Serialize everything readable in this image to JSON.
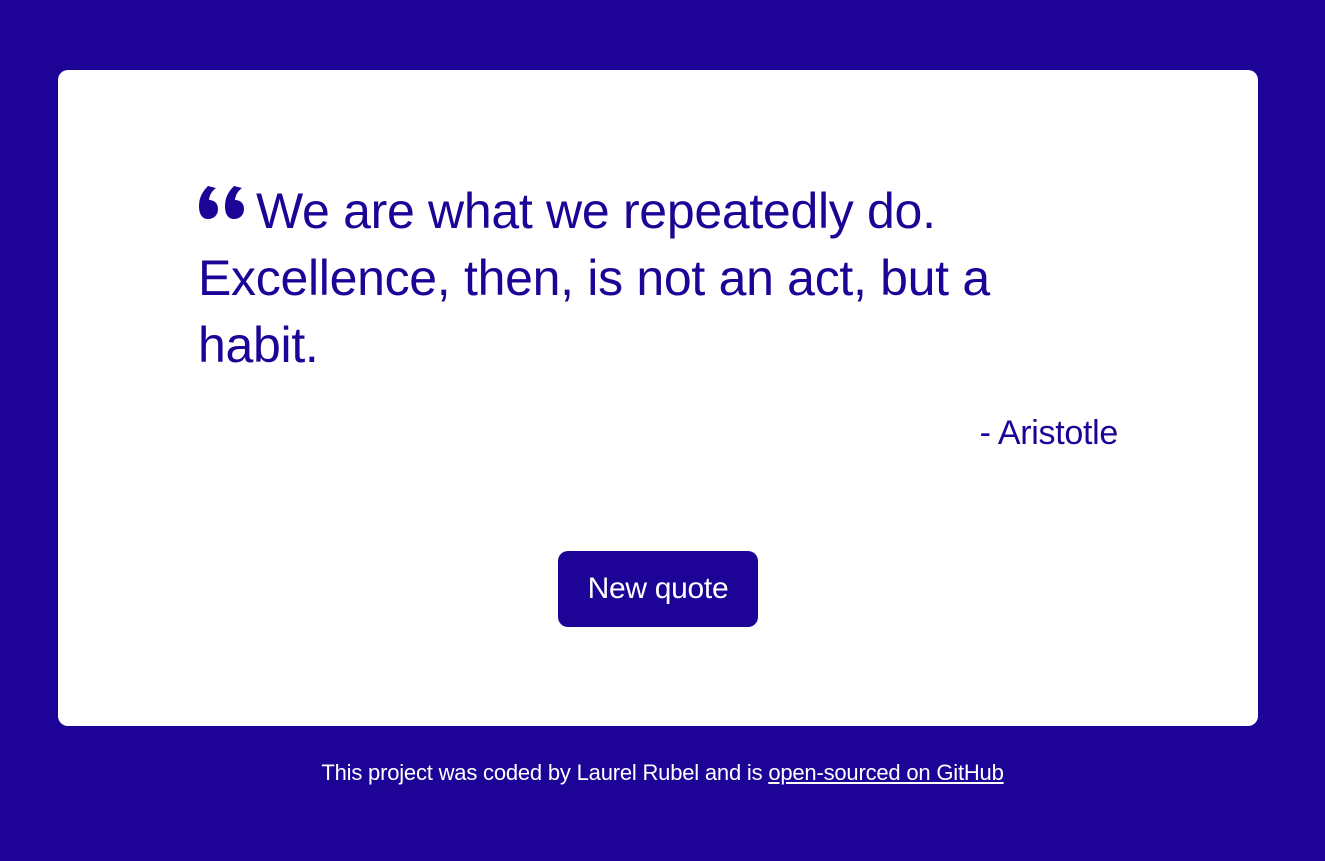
{
  "colors": {
    "background": "#1e0496",
    "card": "#ffffff",
    "accent": "#1e0496",
    "button_text": "#ffffff"
  },
  "quote": {
    "icon": "quote-left-icon",
    "text": "We are what we repeatedly do. Excellence, then, is not an act, but a habit.",
    "author": "- Aristotle"
  },
  "button": {
    "label": "New quote"
  },
  "footer": {
    "text": "This project was coded by Laurel Rubel and is ",
    "link_text": "open-sourced on GitHub"
  }
}
